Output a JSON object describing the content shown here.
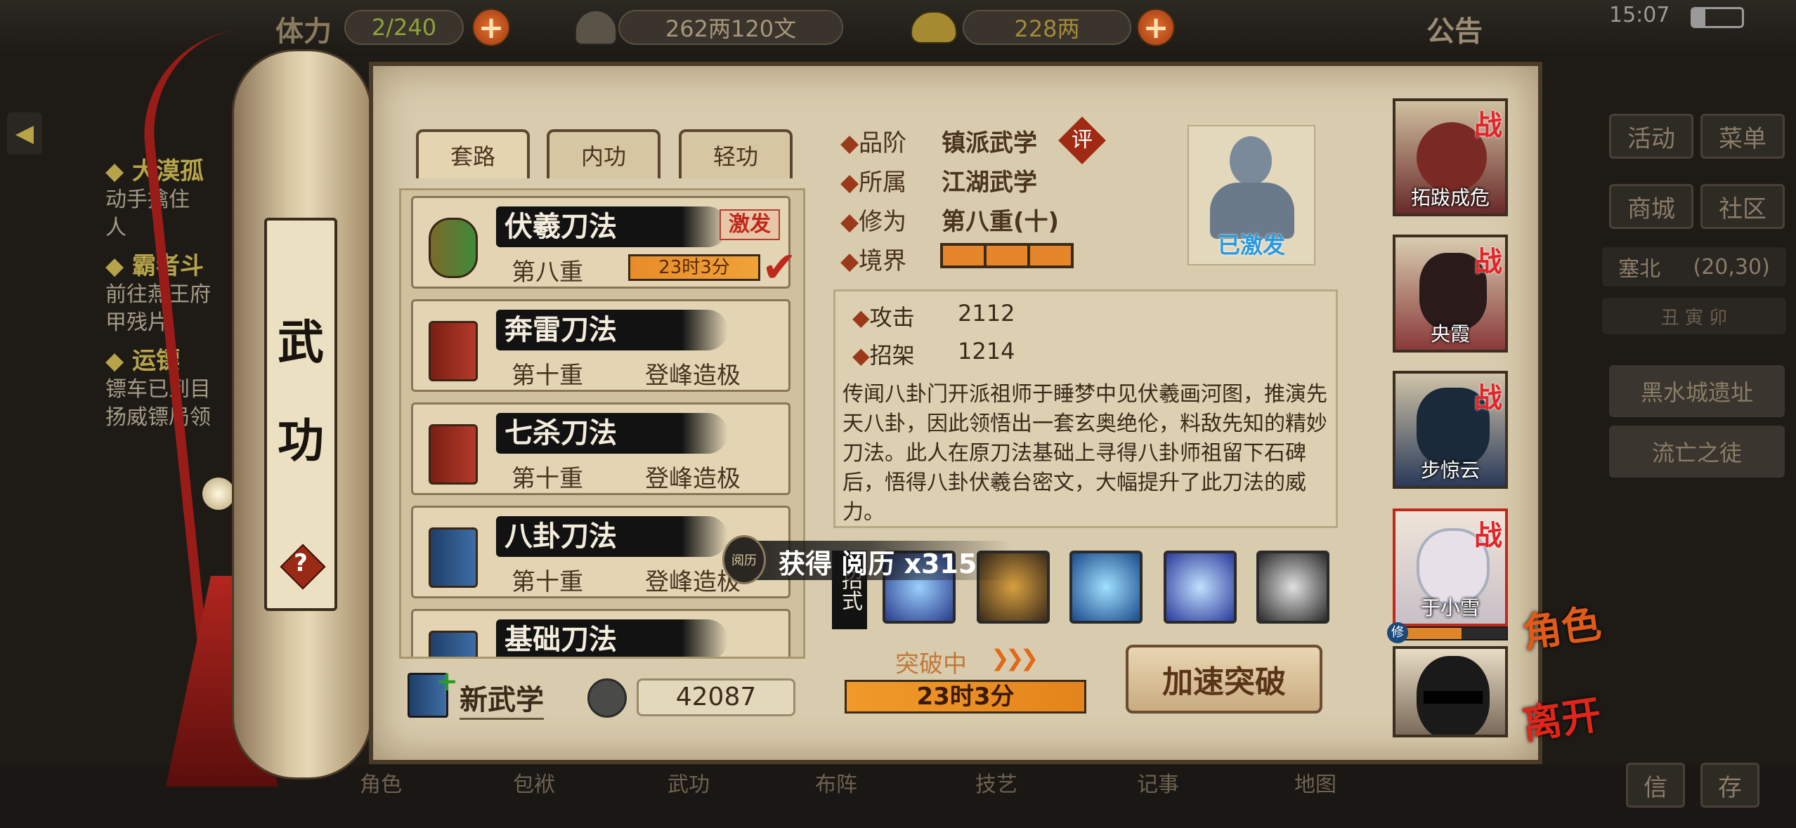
{
  "topbar": {
    "stamina_label": "体力",
    "stamina_value": "2/240",
    "silver_value": "262两120文",
    "gold_value": "228两",
    "announcement": "公告",
    "time": "15:07"
  },
  "quests": [
    {
      "title": "大漠孤",
      "text": "动手擒住\n人"
    },
    {
      "title": "霸者斗",
      "text": "前往燕王府\n甲残片"
    },
    {
      "title": "运镖",
      "text": "镖车已到目\n扬威镖局领"
    }
  ],
  "scroll": {
    "title_1": "武",
    "title_2": "功",
    "help": "?"
  },
  "tabs": [
    "套路",
    "内功",
    "轻功"
  ],
  "martial_list": [
    {
      "name": "伏羲刀法",
      "level": "第八重",
      "progress_text": "23时3分",
      "badge": "激发",
      "color": "green"
    },
    {
      "name": "奔雷刀法",
      "level": "第十重",
      "status": "登峰造极",
      "color": "red"
    },
    {
      "name": "七杀刀法",
      "level": "第十重",
      "status": "登峰造极",
      "color": "red"
    },
    {
      "name": "八卦刀法",
      "level": "第十重",
      "status": "登峰造极",
      "color": "blue"
    },
    {
      "name": "基础刀法",
      "level": "",
      "status": "",
      "color": "blue"
    }
  ],
  "new_learn": {
    "label": "新武学",
    "points": "42087"
  },
  "detail": {
    "grade_label": "品阶",
    "grade_value": "镇派武学",
    "grade_badge": "评",
    "belong_label": "所属",
    "belong_value": "江湖武学",
    "cultivation_label": "修为",
    "cultivation_value": "第八重(十)",
    "realm_label": "境界",
    "activated": "已激发",
    "attack_label": "攻击",
    "attack_value": "2112",
    "parry_label": "招架",
    "parry_value": "1214",
    "description": "传闻八卦门开派祖师于睡梦中见伏羲画河图，推演先天八卦，因此领悟出一套玄奥绝伦，料敌先知的精妙刀法。此人在原刀法基础上寻得八卦师祖留下石碑后，悟得八卦伏羲台密文，大幅提升了此刀法的威力。",
    "moves_label": "招式",
    "breakthrough_label": "突破中",
    "breakthrough_time": "23时3分",
    "speed_button": "加速突破"
  },
  "toast": {
    "icon_text": "阅历",
    "text": "获得 阅历 x315"
  },
  "characters": [
    {
      "name": "拓跋成危",
      "tag": "战"
    },
    {
      "name": "央霞",
      "tag": "战"
    },
    {
      "name": "步惊云",
      "tag": "战"
    },
    {
      "name": "于小雪",
      "tag": "战",
      "sub": "修"
    },
    {
      "name": "",
      "tag": ""
    }
  ],
  "right_menu": {
    "activity": "活动",
    "menu": "菜单",
    "shop": "商城",
    "community": "社区",
    "location": "塞北",
    "coords": "(20,30)",
    "zodiac": "丑 寅 卯",
    "task_1": "黑水城遗址",
    "task_2": "流亡之徒"
  },
  "side_labels": {
    "role": "角色",
    "leave": "离开"
  },
  "bottom_nav": [
    "角色",
    "包袱",
    "武功",
    "布阵",
    "技艺",
    "记事",
    "地图"
  ],
  "bottom_right": [
    "信",
    "存"
  ]
}
